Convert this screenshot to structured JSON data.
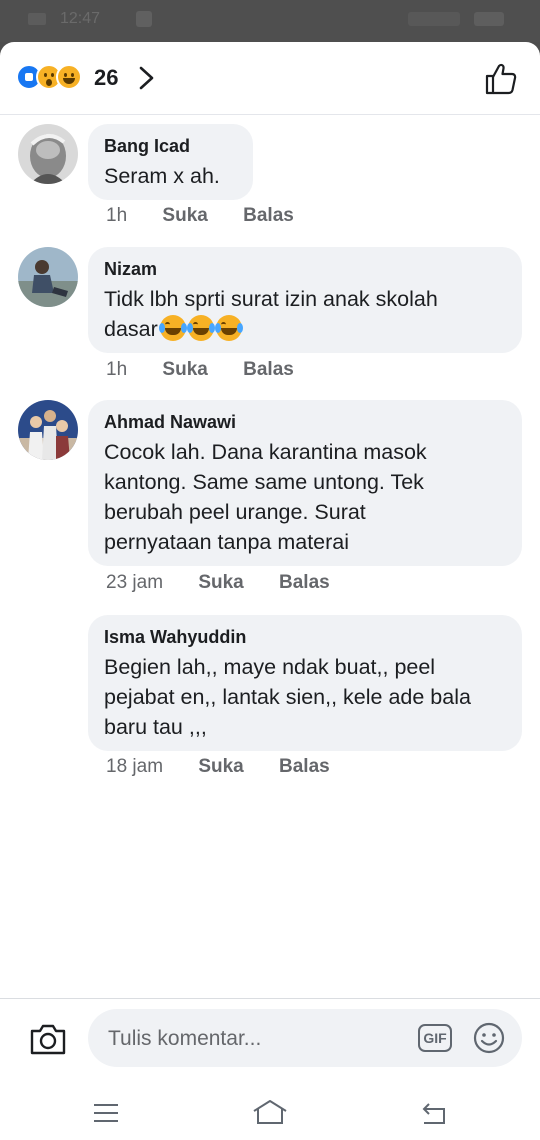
{
  "status_bar": {
    "time": "12:47"
  },
  "header": {
    "reactions": [
      "like-reaction",
      "wow-reaction",
      "haha-reaction"
    ],
    "reaction_count": "26"
  },
  "comments": [
    {
      "author": "Bang Icad",
      "text": "Seram x ah.",
      "time": "1h",
      "like_label": "Suka",
      "reply_label": "Balas"
    },
    {
      "author": "Nizam",
      "text": "Tidk lbh sprti surat izin anak skolah\ndasar",
      "emoji": [
        "crying-laughing-emoji",
        "crying-laughing-emoji",
        "crying-laughing-emoji"
      ],
      "time": "1h",
      "like_label": "Suka",
      "reply_label": "Balas"
    },
    {
      "author": "Ahmad Nawawi",
      "text": "Cocok lah. Dana karantina masok\nkantong. Same same untong. Tek\nberubah peel urange. Surat\npernyataan tanpa materai",
      "time": "23 jam",
      "like_label": "Suka",
      "reply_label": "Balas"
    },
    {
      "author": "Isma Wahyuddin",
      "text": "Begien lah,, maye ndak buat,, peel\npejabat en,, lantak sien,, kele ade bala\nbaru tau ,,,",
      "time": "18 jam",
      "like_label": "Suka",
      "reply_label": "Balas"
    }
  ],
  "composer": {
    "placeholder": "Tulis komentar...",
    "gif_label": "GIF"
  },
  "colors": {
    "accent": "#1877f2",
    "bubble": "#f0f2f5",
    "meta": "#65676b"
  }
}
